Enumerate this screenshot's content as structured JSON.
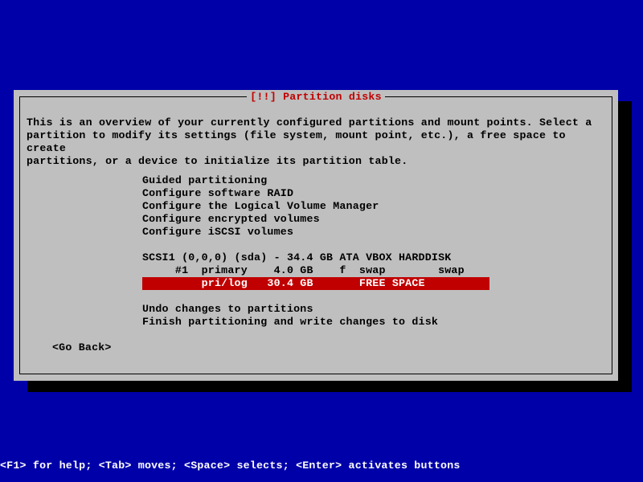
{
  "title": "[!!] Partition disks",
  "body": "This is an overview of your currently configured partitions and mount points. Select a\npartition to modify its settings (file system, mount point, etc.), a free space to create\npartitions, or a device to initialize its partition table.",
  "menu": {
    "guided": "Guided partitioning",
    "raid": "Configure software RAID",
    "lvm": "Configure the Logical Volume Manager",
    "enc": "Configure encrypted volumes",
    "iscsi": "Configure iSCSI volumes",
    "disk": "SCSI1 (0,0,0) (sda) - 34.4 GB ATA VBOX HARDDISK",
    "part1": "     #1  primary    4.0 GB    f  swap        swap",
    "free": "         pri/log   30.4 GB       FREE SPACE",
    "undo": "Undo changes to partitions",
    "finish": "Finish partitioning and write changes to disk"
  },
  "go_back": "<Go Back>",
  "hint": "<F1> for help; <Tab> moves; <Space> selects; <Enter> activates buttons"
}
